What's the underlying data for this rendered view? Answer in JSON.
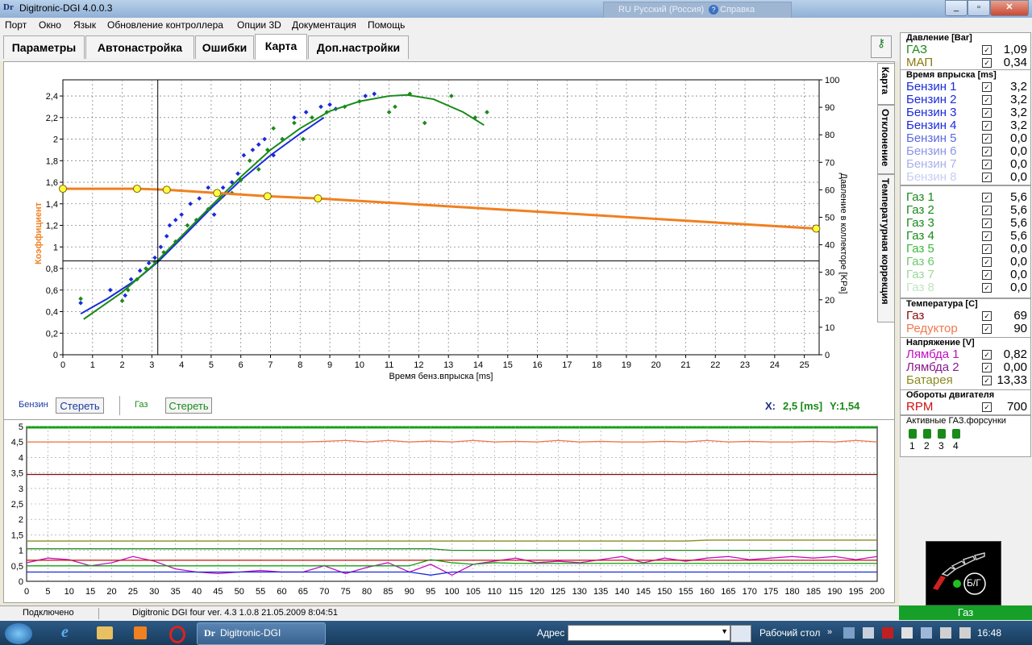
{
  "window": {
    "title": "Digitronic-DGI  4.0.0.3",
    "logo": "Dr",
    "lang_indicator": "RU Русский (Россия)",
    "help": "Справка"
  },
  "menu": [
    "Порт",
    "Окно",
    "Язык",
    "Обновление контроллера",
    "Опции 3D",
    "Документация",
    "Помощь"
  ],
  "tabs": [
    "Параметры",
    "Автонастройка",
    "Ошибки",
    "Карта",
    "Доп.настройки"
  ],
  "vertical_tabs": [
    "Карта",
    "Отклонение",
    "Температурная коррекция"
  ],
  "map": {
    "coef_label": "Коэффициент",
    "x_axis_label": "Время бенз.впрыска [ms]",
    "y2_label": "Давление  в  коллекторе  [KPa]",
    "x_ticks": [
      "0",
      "1",
      "2",
      "3",
      "4",
      "5",
      "6",
      "7",
      "8",
      "9",
      "10",
      "11",
      "12",
      "13",
      "14",
      "15",
      "16",
      "17",
      "18",
      "19",
      "20",
      "21",
      "22",
      "23",
      "24",
      "25"
    ],
    "y_ticks": [
      "0",
      "0,2",
      "0,4",
      "0,6",
      "0,8",
      "1",
      "1,2",
      "1,4",
      "1,6",
      "1,8",
      "2",
      "2,2",
      "2,4"
    ],
    "y2_ticks": [
      "0",
      "10",
      "20",
      "30",
      "40",
      "50",
      "60",
      "70",
      "80",
      "90",
      "100"
    ],
    "benzin_label": "Бензин",
    "benzin_clear": "Стереть",
    "gas_label": "Газ",
    "gas_clear": "Стереть",
    "x_readout_label": "X:",
    "x_readout_value": "2,5 [ms]",
    "y_readout_label": "Y:1,54"
  },
  "chart_data": [
    {
      "type": "scatter",
      "xlabel": "Время бенз.впрыска [ms]",
      "ylabel": "Коэффициент",
      "y2label": "Давление  в  коллекторе  [KPa]",
      "xlim": [
        0,
        25.5
      ],
      "ylim": [
        0,
        2.55
      ],
      "y2lim": [
        0,
        100
      ],
      "series": [
        {
          "name": "Бензин",
          "color": "#1a2adc",
          "x": [
            0.6,
            1.6,
            2.1,
            2.3,
            2.6,
            2.9,
            3.1,
            3.3,
            3.5,
            3.6,
            3.8,
            4.0,
            4.3,
            4.6,
            4.9,
            5.1,
            5.4,
            5.7,
            5.9,
            6.1,
            6.4,
            6.6,
            6.8,
            7.1,
            7.4,
            7.8,
            8.2,
            8.7,
            9.0,
            9.2,
            10.2,
            10.5
          ],
          "y": [
            0.48,
            0.6,
            0.55,
            0.7,
            0.78,
            0.85,
            0.9,
            1.0,
            1.1,
            1.2,
            1.25,
            1.3,
            1.4,
            1.45,
            1.55,
            1.3,
            1.55,
            1.6,
            1.68,
            1.85,
            1.9,
            1.95,
            2.0,
            1.85,
            2.0,
            2.2,
            2.25,
            2.3,
            2.32,
            2.28,
            2.4,
            2.42
          ],
          "fit_x": [
            0.6,
            1.5,
            2.5,
            3.2,
            4.0,
            5.0,
            6.0,
            7.0,
            8.0,
            8.8
          ],
          "fit_y": [
            0.38,
            0.52,
            0.7,
            0.86,
            1.08,
            1.36,
            1.62,
            1.85,
            2.05,
            2.2
          ]
        },
        {
          "name": "Газ",
          "color": "#1a8a1a",
          "x": [
            0.6,
            2.0,
            2.2,
            2.5,
            2.8,
            3.1,
            3.4,
            3.8,
            4.2,
            4.5,
            4.9,
            5.3,
            5.7,
            6.0,
            6.3,
            6.6,
            6.9,
            7.1,
            7.4,
            7.8,
            8.1,
            8.4,
            8.9,
            9.5,
            10.0,
            11.0,
            11.2,
            11.7,
            12.2,
            13.1,
            13.9,
            14.3
          ],
          "y": [
            0.52,
            0.5,
            0.6,
            0.7,
            0.8,
            0.86,
            0.95,
            1.05,
            1.2,
            1.25,
            1.35,
            1.45,
            1.5,
            1.62,
            1.8,
            1.72,
            1.9,
            2.1,
            2.0,
            2.15,
            2.0,
            2.2,
            2.25,
            2.3,
            2.35,
            2.25,
            2.3,
            2.42,
            2.15,
            2.4,
            2.2,
            2.25
          ],
          "fit_x": [
            0.7,
            2,
            3,
            4,
            5,
            6,
            7,
            8,
            9,
            10,
            11,
            11.6,
            12.5,
            13.5,
            14.2
          ],
          "fit_y": [
            0.33,
            0.58,
            0.82,
            1.1,
            1.38,
            1.65,
            1.9,
            2.1,
            2.26,
            2.35,
            2.4,
            2.41,
            2.37,
            2.25,
            2.13
          ]
        },
        {
          "name": "Коэффициент",
          "color": "#f08020",
          "x": [
            0,
            2.5,
            3.5,
            5.2,
            6.9,
            8.6,
            25.4
          ],
          "y": [
            1.54,
            1.54,
            1.53,
            1.5,
            1.47,
            1.45,
            1.17
          ],
          "points": [
            0,
            2.5,
            3.5,
            5.2,
            6.9,
            8.6,
            25.4
          ]
        }
      ],
      "cursor": {
        "x": 3.2,
        "y": 0.87
      }
    },
    {
      "type": "line",
      "xlim": [
        0,
        200
      ],
      "ylim": [
        0,
        5
      ],
      "x_ticks": [
        "0",
        "5",
        "10",
        "15",
        "20",
        "25",
        "30",
        "35",
        "40",
        "45",
        "50",
        "55",
        "60",
        "65",
        "70",
        "75",
        "80",
        "85",
        "90",
        "95",
        "100",
        "105",
        "110",
        "115",
        "120",
        "125",
        "130",
        "135",
        "140",
        "145",
        "150",
        "155",
        "160",
        "165",
        "170",
        "175",
        "180",
        "185",
        "190",
        "195",
        "200"
      ],
      "y_ticks": [
        "0",
        "0,5",
        "1",
        "1,5",
        "2",
        "2,5",
        "3",
        "3,5",
        "4",
        "4,5",
        "5"
      ],
      "series": [
        {
          "color": "#f07850",
          "values": [
            4.5,
            4.5,
            4.5,
            4.5,
            4.5,
            4.5,
            4.5,
            4.5,
            4.5,
            4.5,
            4.5,
            4.5,
            4.5,
            4.5,
            4.52,
            4.55,
            4.5,
            4.55,
            4.5,
            4.53,
            4.5,
            4.55,
            4.5,
            4.52,
            4.5,
            4.55,
            4.5,
            4.52,
            4.5,
            4.5,
            4.52,
            4.5,
            4.55,
            4.5,
            4.52,
            4.5,
            4.5,
            4.52,
            4.5,
            4.55,
            4.5
          ]
        },
        {
          "color": "#8a0a0a",
          "values": [
            3.45,
            3.45,
            3.45,
            3.45,
            3.45,
            3.45,
            3.45,
            3.45,
            3.45,
            3.45,
            3.45,
            3.45,
            3.45,
            3.45,
            3.45,
            3.45,
            3.45,
            3.45,
            3.45,
            3.45,
            3.45,
            3.45,
            3.45,
            3.45,
            3.45,
            3.45,
            3.45,
            3.45,
            3.45,
            3.45,
            3.45,
            3.45,
            3.45,
            3.45,
            3.45,
            3.45,
            3.45,
            3.45,
            3.45,
            3.45,
            3.45
          ]
        },
        {
          "color": "#8a8a20",
          "values": [
            1.3,
            1.3,
            1.3,
            1.3,
            1.3,
            1.3,
            1.3,
            1.3,
            1.3,
            1.3,
            1.3,
            1.3,
            1.3,
            1.3,
            1.3,
            1.3,
            1.3,
            1.3,
            1.3,
            1.3,
            1.3,
            1.3,
            1.3,
            1.3,
            1.3,
            1.3,
            1.3,
            1.3,
            1.3,
            1.3,
            1.3,
            1.3,
            1.33,
            1.33,
            1.33,
            1.33,
            1.33,
            1.33,
            1.33,
            1.33,
            1.33
          ]
        },
        {
          "color": "#2a8a2a",
          "values": [
            1.05,
            1.05,
            1.05,
            1.05,
            1.05,
            1.05,
            1.05,
            1.05,
            1.05,
            1.05,
            1.05,
            1.05,
            1.05,
            1.05,
            1.05,
            1.05,
            1.05,
            1.05,
            1.05,
            1.05,
            1.0,
            1.0,
            1.0,
            1.0,
            1.0,
            1.0,
            1.0,
            1.0,
            1.0,
            1.0,
            1.0,
            1.0,
            1.0,
            1.0,
            1.0,
            1.0,
            1.0,
            1.0,
            1.0,
            1.0,
            1.0
          ]
        },
        {
          "color": "#c010c0",
          "values": [
            0.6,
            0.75,
            0.7,
            0.5,
            0.6,
            0.8,
            0.65,
            0.4,
            0.3,
            0.25,
            0.3,
            0.35,
            0.3,
            0.3,
            0.5,
            0.25,
            0.45,
            0.6,
            0.3,
            0.55,
            0.2,
            0.55,
            0.65,
            0.75,
            0.6,
            0.65,
            0.6,
            0.7,
            0.8,
            0.6,
            0.75,
            0.65,
            0.75,
            0.8,
            0.7,
            0.75,
            0.8,
            0.75,
            0.8,
            0.7,
            0.8
          ]
        },
        {
          "color": "#c81010",
          "values": [
            0.68,
            0.68,
            0.68,
            0.68,
            0.68,
            0.68,
            0.68,
            0.68,
            0.68,
            0.68,
            0.68,
            0.68,
            0.68,
            0.68,
            0.68,
            0.68,
            0.68,
            0.68,
            0.68,
            0.68,
            0.68,
            0.68,
            0.68,
            0.68,
            0.68,
            0.68,
            0.68,
            0.68,
            0.68,
            0.68,
            0.68,
            0.68,
            0.68,
            0.68,
            0.68,
            0.68,
            0.68,
            0.68,
            0.68,
            0.68,
            0.68
          ]
        },
        {
          "color": "#10a010",
          "values": [
            0.5,
            0.5,
            0.5,
            0.5,
            0.5,
            0.5,
            0.5,
            0.5,
            0.5,
            0.5,
            0.5,
            0.5,
            0.5,
            0.5,
            0.5,
            0.5,
            0.5,
            0.5,
            0.5,
            0.7,
            0.6,
            0.55,
            0.6,
            0.58,
            0.58,
            0.58,
            0.58,
            0.58,
            0.58,
            0.58,
            0.58,
            0.58,
            0.58,
            0.58,
            0.58,
            0.58,
            0.58,
            0.58,
            0.58,
            0.58,
            0.58
          ]
        },
        {
          "color": "#1a2adc",
          "values": [
            0.3,
            0.3,
            0.3,
            0.3,
            0.3,
            0.3,
            0.3,
            0.3,
            0.3,
            0.3,
            0.3,
            0.3,
            0.3,
            0.3,
            0.3,
            0.3,
            0.3,
            0.3,
            0.3,
            0.2,
            0.3,
            0.3,
            0.3,
            0.3,
            0.3,
            0.3,
            0.3,
            0.3,
            0.3,
            0.3,
            0.3,
            0.3,
            0.3,
            0.3,
            0.3,
            0.3,
            0.3,
            0.3,
            0.3,
            0.3,
            0.3
          ]
        }
      ]
    }
  ],
  "right_panel": {
    "pressure": {
      "title": "Давление [Bar]",
      "rows": [
        {
          "name": "ГАЗ",
          "value": "1,09",
          "color": "#1a8a1a"
        },
        {
          "name": "МАП",
          "value": "0,34",
          "color": "#8a7a10"
        }
      ]
    },
    "injection": {
      "title": "Время впрыска [ms]",
      "benzin": [
        {
          "name": "Бензин 1",
          "value": "3,2",
          "color": "#1a2adc"
        },
        {
          "name": "Бензин 2",
          "value": "3,2",
          "color": "#1a2adc"
        },
        {
          "name": "Бензин 3",
          "value": "3,2",
          "color": "#1a2adc"
        },
        {
          "name": "Бензин 4",
          "value": "3,2",
          "color": "#1a2adc"
        },
        {
          "name": "Бензин 5",
          "value": "0,0",
          "color": "#5a6ae0"
        },
        {
          "name": "Бензин 6",
          "value": "0,0",
          "color": "#8a94e8"
        },
        {
          "name": "Бензин 7",
          "value": "0,0",
          "color": "#a8b0ee"
        },
        {
          "name": "Бензин 8",
          "value": "0,0",
          "color": "#c8ccf4"
        }
      ],
      "gas": [
        {
          "name": "Газ 1",
          "value": "5,6",
          "color": "#1a8a1a"
        },
        {
          "name": "Газ 2",
          "value": "5,6",
          "color": "#1a8a1a"
        },
        {
          "name": "Газ 3",
          "value": "5,6",
          "color": "#1a8a1a"
        },
        {
          "name": "Газ 4",
          "value": "5,6",
          "color": "#1a8a1a"
        },
        {
          "name": "Газ 5",
          "value": "0,0",
          "color": "#3ab83a"
        },
        {
          "name": "Газ 6",
          "value": "0,0",
          "color": "#6cc86c"
        },
        {
          "name": "Газ 7",
          "value": "0,0",
          "color": "#9cd89c"
        },
        {
          "name": "Газ 8",
          "value": "0,0",
          "color": "#c0e6c0"
        }
      ]
    },
    "temperature": {
      "title": "Температура  [C]",
      "rows": [
        {
          "name": "Газ",
          "value": "69",
          "color": "#8a0a0a"
        },
        {
          "name": "Редуктор",
          "value": "90",
          "color": "#f07850"
        }
      ]
    },
    "voltage": {
      "title": "Напряжение [V]",
      "rows": [
        {
          "name": "Лямбда 1",
          "value": "0,82",
          "color": "#c010c0"
        },
        {
          "name": "Лямбда 2",
          "value": "0,00",
          "color": "#8a1a8a"
        },
        {
          "name": "Батарея",
          "value": "13,33",
          "color": "#8a8a20"
        }
      ]
    },
    "rpm": {
      "title": "Обороты двигателя",
      "name": "RPM",
      "value": "700",
      "color": "#d01010"
    },
    "injectors": {
      "title": "Активные ГАЗ.форсунки",
      "labels": [
        "1",
        "2",
        "3",
        "4"
      ]
    }
  },
  "indicator_label": "Б/Г",
  "gas_status": "Газ",
  "statusbar": {
    "connection": "Подключено",
    "device": "Digitronic DGI four   ver. 4.3  1.0.8    21.05.2009 8:04:51"
  },
  "taskbar": {
    "app_label": "Digitronic-DGI",
    "address_label": "Адрес",
    "desktop_label": "Рабочий стол",
    "clock": "16:48"
  }
}
